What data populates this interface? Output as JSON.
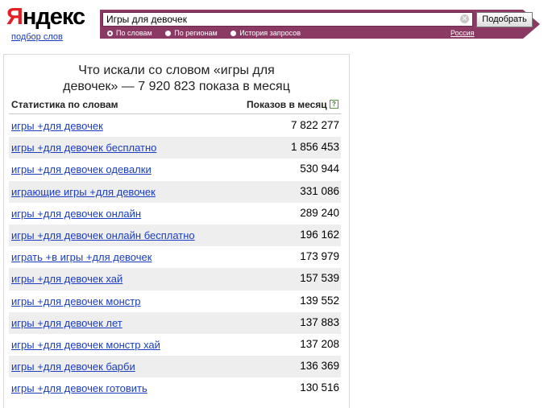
{
  "header": {
    "logo_first": "Я",
    "logo_rest": "ндекс",
    "service_link": "подбор слов",
    "search_value": "Игры для девочек",
    "submit_label": "Подобрать",
    "radio_options": [
      "По словам",
      "По регионам",
      "История запросов"
    ],
    "radio_selected": 0,
    "region": "Россия"
  },
  "results": {
    "title_line1": "Что искали со словом «игры для",
    "title_line2": "девочек» — 7 920 823 показа в месяц",
    "col_keywords": "Статистика по словам",
    "col_count": "Показов в месяц",
    "help_glyph": "?",
    "rows": [
      {
        "keyword": "игры +для девочек",
        "count": "7 822 277"
      },
      {
        "keyword": "игры +для девочек бесплатно",
        "count": "1 856 453"
      },
      {
        "keyword": "игры +для девочек одевалки",
        "count": "530 944"
      },
      {
        "keyword": "играющие игры +для девочек",
        "count": "331 086"
      },
      {
        "keyword": "игры +для девочек онлайн",
        "count": "289 240"
      },
      {
        "keyword": "игры +для девочек онлайн бесплатно",
        "count": "196 162"
      },
      {
        "keyword": "играть +в игры +для девочек",
        "count": "173 979"
      },
      {
        "keyword": "игры +для девочек хай",
        "count": "157 539"
      },
      {
        "keyword": "игры +для девочек монстр",
        "count": "139 552"
      },
      {
        "keyword": "игры +для девочек лет",
        "count": "137 883"
      },
      {
        "keyword": "игры +для девочек монстр хай",
        "count": "137 208"
      },
      {
        "keyword": "игры +для девочек барби",
        "count": "136 369"
      },
      {
        "keyword": "игры +для девочек готовить",
        "count": "130 516"
      }
    ]
  },
  "colors": {
    "brand_red": "#e31e24",
    "panel": "#8b3a63",
    "link": "#1a3dc1"
  }
}
